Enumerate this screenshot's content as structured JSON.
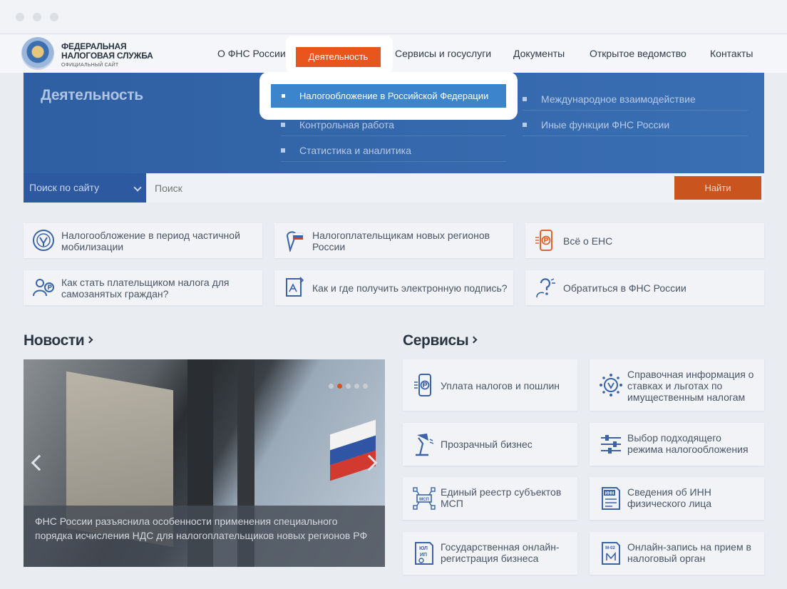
{
  "colors": {
    "accent": "#e8561e",
    "brand_blue": "#2f5fa3",
    "highlight_blue": "#3c84cb"
  },
  "logo": {
    "line1": "ФЕДЕРАЛЬНАЯ",
    "line2": "НАЛОГОВАЯ СЛУЖБА",
    "line3": "ОФИЦИАЛЬНЫЙ САЙТ"
  },
  "nav": {
    "items": [
      "О ФНС России",
      "Деятельность",
      "Сервисы и госуслуги",
      "Документы",
      "Открытое ведомство",
      "Контакты"
    ]
  },
  "menu": {
    "title": "Деятельность",
    "left_items": [
      "Налогообложение в Российской Федерации",
      "Контрольная работа",
      "Статистика и аналитика"
    ],
    "right_items": [
      "Международное взаимодействие",
      "Иные функции ФНС России"
    ]
  },
  "search": {
    "scope_label": "Поиск по сайту",
    "placeholder": "Поиск",
    "button_label": "Найти"
  },
  "quick_links": [
    {
      "text": "Налогообложение в период частичной мобилизации",
      "icon": "emblem-icon"
    },
    {
      "text": "Налогоплательщикам новых регионов России",
      "icon": "map-pin-flag-icon"
    },
    {
      "text": "Всё о ЕНС",
      "icon": "phone-ruble-icon"
    },
    {
      "text": "Как стать плательщиком налога для самозанятых граждан?",
      "icon": "self-employed-icon"
    },
    {
      "text": "Как и где получить электронную подпись?",
      "icon": "signature-icon"
    },
    {
      "text": "Обратиться в ФНС России",
      "icon": "question-person-icon"
    }
  ],
  "news": {
    "title": "Новости",
    "caption": "ФНС России разъяснила особенности применения специального порядка исчисления НДС для налогоплательщиков новых регионов РФ",
    "slide_count": 5,
    "active_slide": 2
  },
  "services": {
    "title": "Сервисы",
    "items": [
      {
        "text": "Уплата налогов и пошлин",
        "icon": "phone-ruble-icon"
      },
      {
        "text": "Справочная информация о ставках и льготах по имущественным налогам",
        "icon": "emblem-gear-icon"
      },
      {
        "text": "Прозрачный бизнес",
        "icon": "lamp-icon"
      },
      {
        "text": "Выбор подходящего режима налогообложения",
        "icon": "sliders-icon"
      },
      {
        "text": "Единый реестр субъектов МСП",
        "icon": "msp-network-icon"
      },
      {
        "text": "Сведения об ИНН физического лица",
        "icon": "inn-document-icon"
      },
      {
        "text": "Государственная онлайн-регистрация бизнеса",
        "icon": "ul-ip-document-icon"
      },
      {
        "text": "Онлайн-запись на прием в налоговый орган",
        "icon": "m02-document-icon"
      }
    ],
    "icon_labels": {
      "msp": "МСП",
      "inn": "ИНН",
      "ul": "ЮЛ",
      "ip": "ИП",
      "m02": "М-02"
    }
  }
}
